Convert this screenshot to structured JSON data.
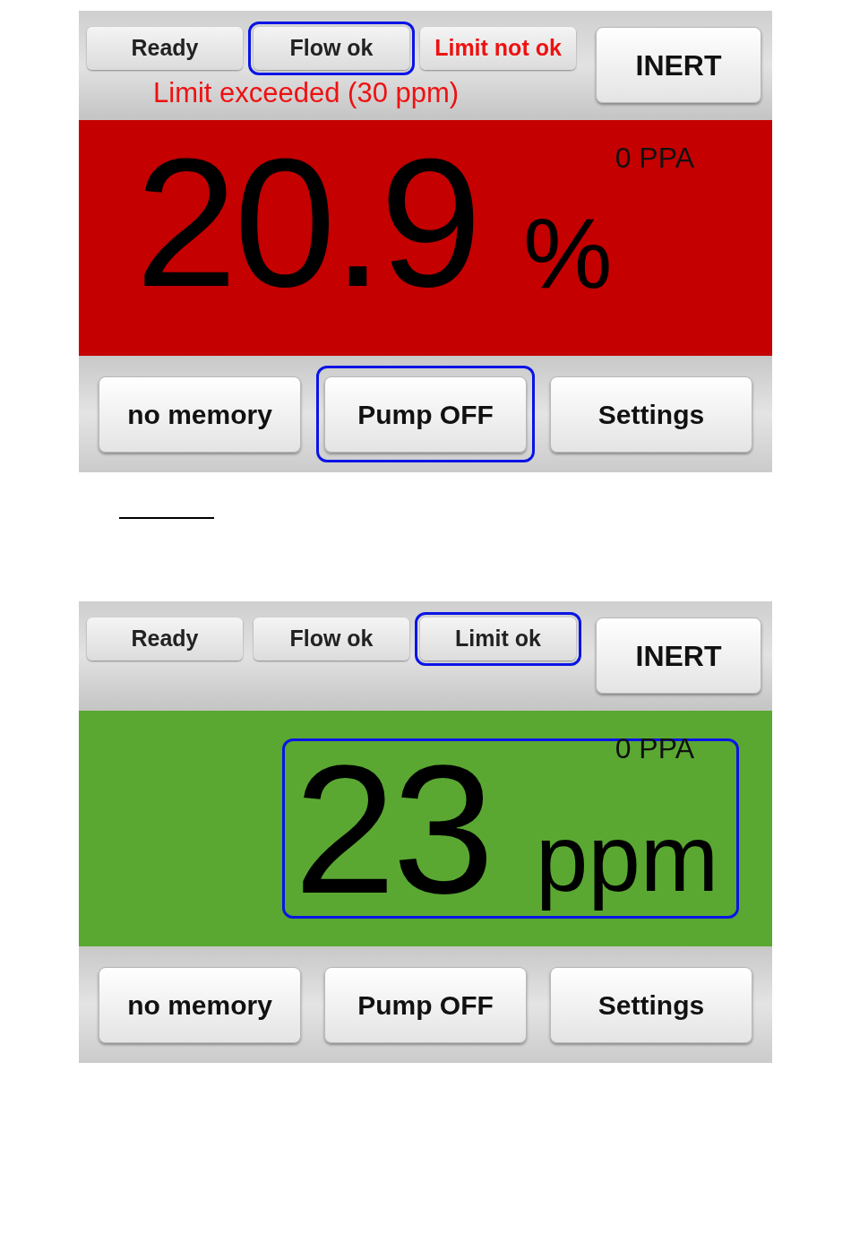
{
  "screens": [
    {
      "status_buttons": [
        {
          "label": "Ready",
          "alert": false,
          "highlighted": false
        },
        {
          "label": "Flow ok",
          "alert": false,
          "highlighted": true
        },
        {
          "label": "Limit not ok",
          "alert": true,
          "highlighted": false
        }
      ],
      "mode_button": "INERT",
      "warning": "Limit exceeded (30 ppm)",
      "display": {
        "kind": "alarm",
        "color": "#c40000",
        "value": "20.9",
        "unit": "%",
        "secondary": "0 PPA",
        "highlighted": false
      },
      "buttons": [
        {
          "label": "no memory",
          "highlighted": false
        },
        {
          "label": "Pump OFF",
          "highlighted": true
        },
        {
          "label": "Settings",
          "highlighted": false
        }
      ]
    },
    {
      "status_buttons": [
        {
          "label": "Ready",
          "alert": false,
          "highlighted": false
        },
        {
          "label": "Flow ok",
          "alert": false,
          "highlighted": false
        },
        {
          "label": "Limit ok",
          "alert": false,
          "highlighted": true
        }
      ],
      "mode_button": "INERT",
      "display": {
        "kind": "normal",
        "color": "#5aa832",
        "value": "23",
        "unit": "ppm",
        "secondary": "0 PPA",
        "highlighted": true
      },
      "buttons": [
        {
          "label": "no memory",
          "highlighted": false
        },
        {
          "label": "Pump OFF",
          "highlighted": false
        },
        {
          "label": "Settings",
          "highlighted": false
        }
      ]
    }
  ]
}
